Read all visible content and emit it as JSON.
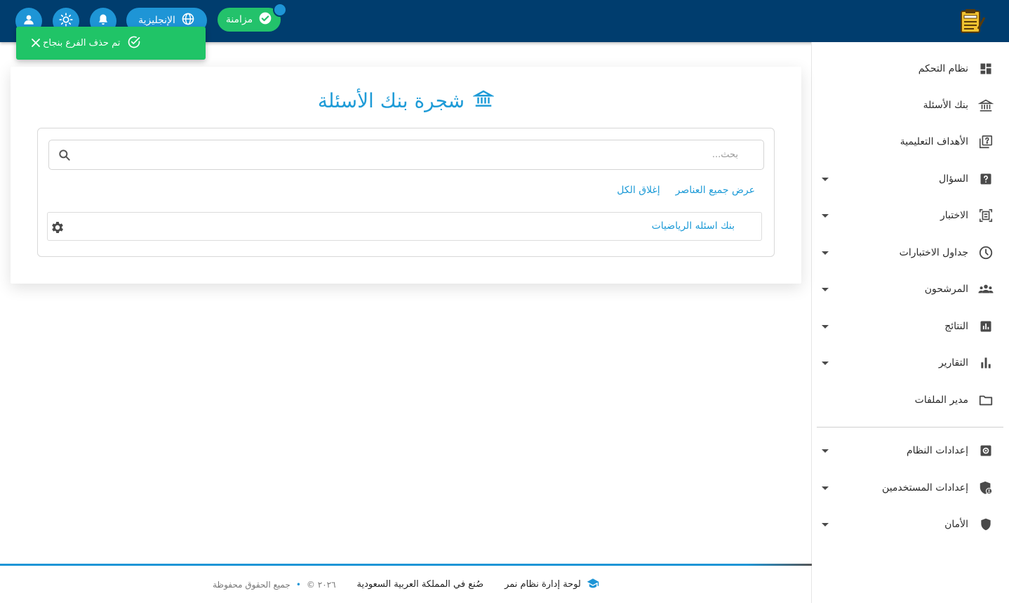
{
  "header": {
    "sync_label": "مزامنة",
    "language_label": "الإنجليزية"
  },
  "toast": {
    "message": "تم حذف الفرع بنجاح"
  },
  "sidebar": {
    "items": [
      {
        "label": "نظام التحكم",
        "icon": "dashboard-icon"
      },
      {
        "label": "بنك الأسئلة",
        "icon": "bank-icon"
      },
      {
        "label": "الأهداف التعليمية",
        "icon": "objectives-icon"
      },
      {
        "label": "السؤال",
        "icon": "question-icon"
      },
      {
        "label": "الاختبار",
        "icon": "exam-icon"
      },
      {
        "label": "جداول الاختبارات",
        "icon": "clock-icon"
      },
      {
        "label": "المرشحون",
        "icon": "people-icon"
      },
      {
        "label": "النتائج",
        "icon": "results-icon"
      },
      {
        "label": "التقارير",
        "icon": "bar-chart-icon"
      },
      {
        "label": "مدير الملفات",
        "icon": "folder-icon"
      },
      {
        "label": "إعدادات النظام",
        "icon": "settings-icon"
      },
      {
        "label": "إعدادات المستخدمين",
        "icon": "user-shield-icon"
      },
      {
        "label": "الأمان",
        "icon": "shield-icon"
      }
    ]
  },
  "main": {
    "title": "شجرة بنك الأسئلة",
    "search_placeholder": "بحث...",
    "show_all_label": "عرض جميع العناصر",
    "collapse_all_label": "إغلاق الكل",
    "tree_nodes": [
      {
        "label": "بنك اسئله الرياضيات"
      }
    ]
  },
  "footer": {
    "brand": "لوحة إدارة نظام نمر",
    "made_in": "صُنع في المملكة العربية السعودية",
    "year": "© ٢٠٢٦",
    "rights": "جميع الحقوق محفوظة"
  },
  "colors": {
    "header_bg": "#003d6e",
    "accent": "#1e95d6",
    "success": "#20c467"
  }
}
